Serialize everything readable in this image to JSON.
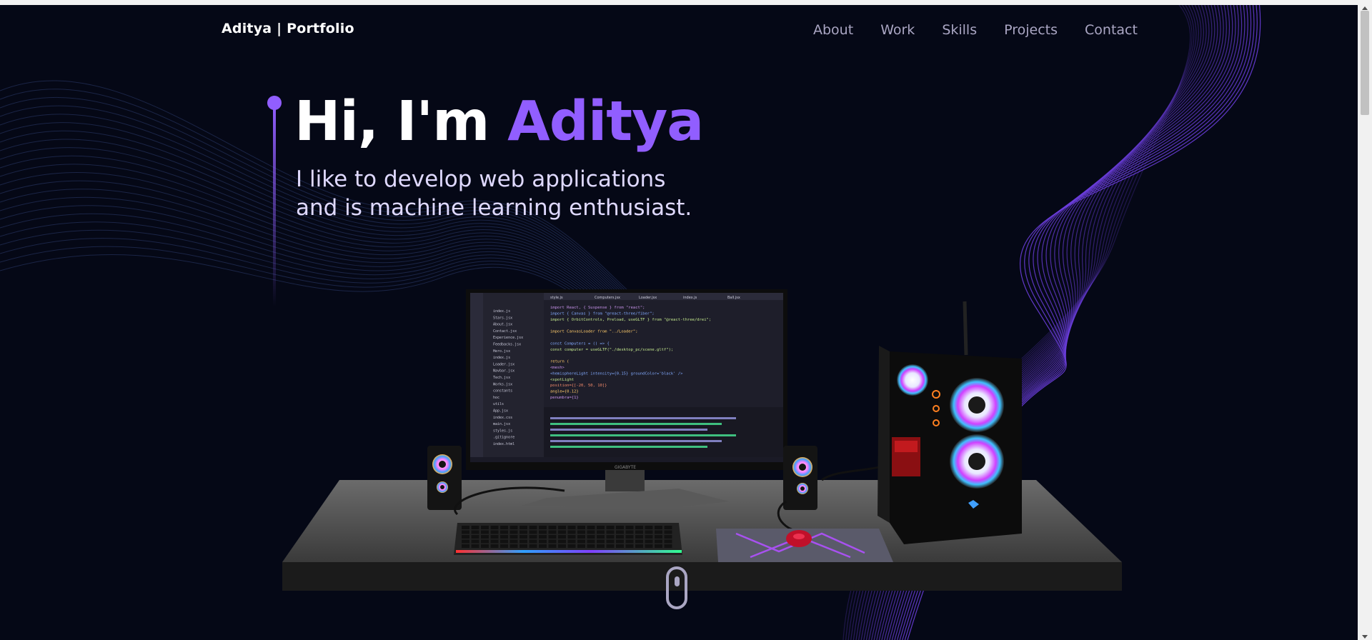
{
  "navbar": {
    "logo": "Aditya | Portfolio",
    "links": [
      "About",
      "Work",
      "Skills",
      "Projects",
      "Contact"
    ]
  },
  "hero": {
    "greeting": "Hi, I'm ",
    "name": "Aditya",
    "subtitle_line1": "I like to develop web applications",
    "subtitle_line2": "and is machine learning enthusiast."
  },
  "scene": {
    "monitor_brand": "GIGABYTE",
    "editor_tabs": [
      "style.js",
      "Computers.jsx",
      "Loader.jsx",
      "index.js",
      "Ball.jsx"
    ],
    "file_tree": [
      "index.js",
      "Stars.jsx",
      "About.jsx",
      "Contact.jsx",
      "Experience.jsx",
      "Feedbacks.jsx",
      "Hero.jsx",
      "index.js",
      "Loader.jsx",
      "Navbar.jsx",
      "Tech.jsx",
      "Works.jsx",
      "constants",
      "hoc",
      "utils",
      "App.jsx",
      "index.css",
      "main.jsx",
      "styles.js",
      ".gitignore",
      "index.html"
    ],
    "code_lines": [
      "import React, { Suspense } from \"react\";",
      "import { Canvas } from \"@react-three/fiber\";",
      "import { OrbitControls, Preload, useGLTF } from \"@react-three/drei\";",
      "",
      "import CanvasLoader from \"../Loader\";",
      "",
      "const Computers = () => {",
      "  const computer = useGLTF(\"./desktop_pc/scene.gltf\");",
      "",
      "  return (",
      "    <mesh>",
      "      <hemisphereLight intensity={0.15} groundColor='black' />",
      "      <spotLight",
      "        position={[-20, 50, 10]}",
      "        angle={0.12}",
      "        penumbra={1}"
    ]
  },
  "colors": {
    "background": "#050816",
    "accent": "#915eff",
    "text_secondary": "#aaa6c3"
  }
}
